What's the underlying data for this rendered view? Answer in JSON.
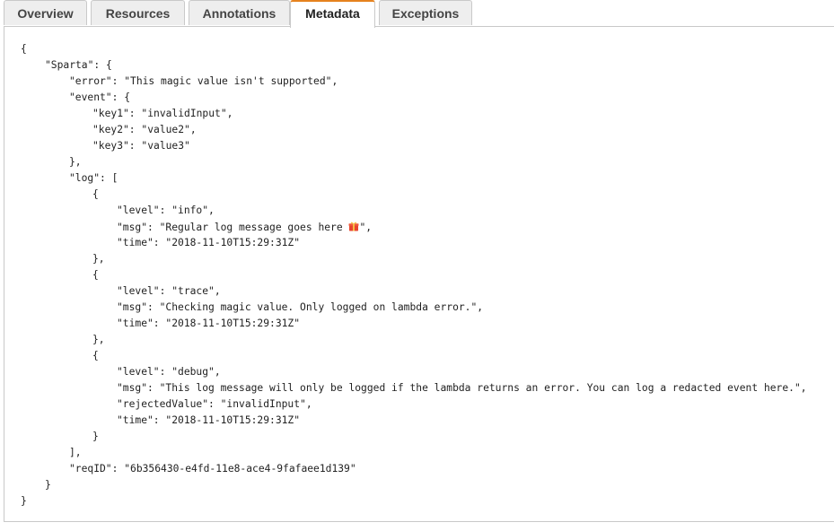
{
  "tabs": [
    {
      "label": "Overview",
      "active": false
    },
    {
      "label": "Resources",
      "active": false
    },
    {
      "label": "Annotations",
      "active": false
    },
    {
      "label": "Metadata",
      "active": true
    },
    {
      "label": "Exceptions",
      "active": false
    }
  ],
  "colors": {
    "active_tab_accent": "#e6821e",
    "border": "#c9c9c9",
    "tab_bg": "#eeeeee"
  },
  "metadata_lines": [
    "{",
    "\"Sparta\": {",
    "\"error\": \"This magic value isn't supported\",",
    "\"event\": {",
    "\"key1\": \"invalidInput\",",
    "\"key2\": \"value2\",",
    "\"key3\": \"value3\"",
    "},",
    "\"log\": [",
    "{",
    "\"level\": \"info\",",
    "\"msg\": \"Regular log message goes here ",
    "\"time\": \"2018-11-10T15:29:31Z\"",
    "},",
    "{",
    "\"level\": \"trace\",",
    "\"msg\": \"Checking magic value. Only logged on lambda error.\",",
    "\"time\": \"2018-11-10T15:29:31Z\"",
    "},",
    "{",
    "\"level\": \"debug\",",
    "\"msg\": \"This log message will only be logged if the lambda returns an error. You can log a redacted event here.\",",
    "\"rejectedValue\": \"invalidInput\",",
    "\"time\": \"2018-11-10T15:29:31Z\"",
    "}",
    "],",
    "\"reqID\": \"6b356430-e4fd-11e8-ace4-9fafaee1d139\"",
    "}",
    "}"
  ],
  "msg_line_tail": "\",",
  "gift_icon": "gift-icon"
}
